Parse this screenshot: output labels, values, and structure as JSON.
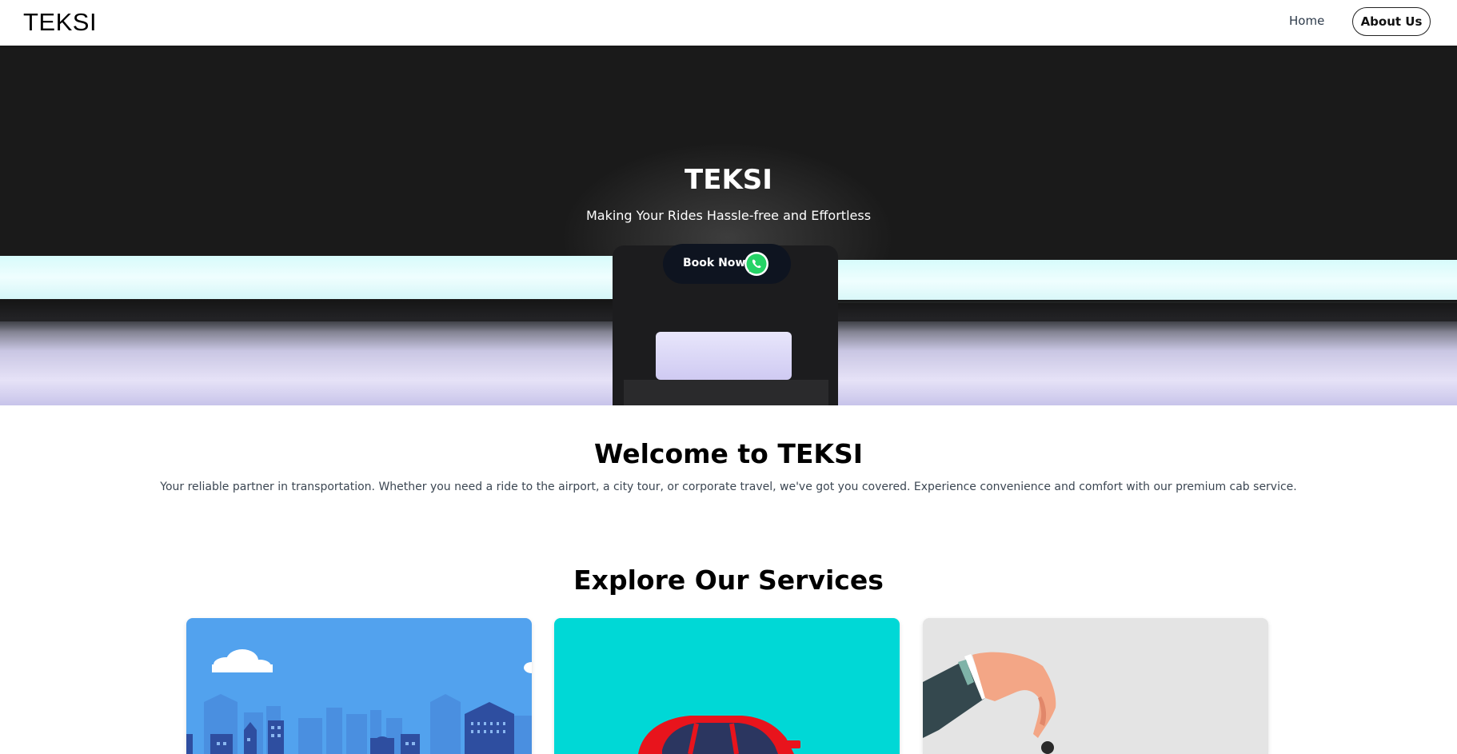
{
  "navbar": {
    "brand": "TEKSI",
    "home_label": "Home",
    "about_label": "About Us"
  },
  "hero": {
    "title": "TEKSI",
    "subtitle": "Making Your Rides Hassle-free and Effortless",
    "book_label": "Book Now",
    "book_icon": "whatsapp-icon"
  },
  "welcome": {
    "title": "Welcome to TEKSI",
    "text": "Your reliable partner in transportation. Whether you need a ride to the airport, a city tour, or corporate travel, we've got you covered. Experience convenience and comfort with our premium cab service."
  },
  "services": {
    "title": "Explore Our Services",
    "cards": [
      {
        "image": "city-skyline-illustration",
        "bg": "#52a2ee"
      },
      {
        "image": "red-car-illustration",
        "bg": "#00d8d6"
      },
      {
        "image": "hand-with-car-key-illustration",
        "bg": "#e4e4e4"
      }
    ]
  },
  "colors": {
    "accent_dark": "#0e1420",
    "whatsapp_green": "#25d366"
  }
}
